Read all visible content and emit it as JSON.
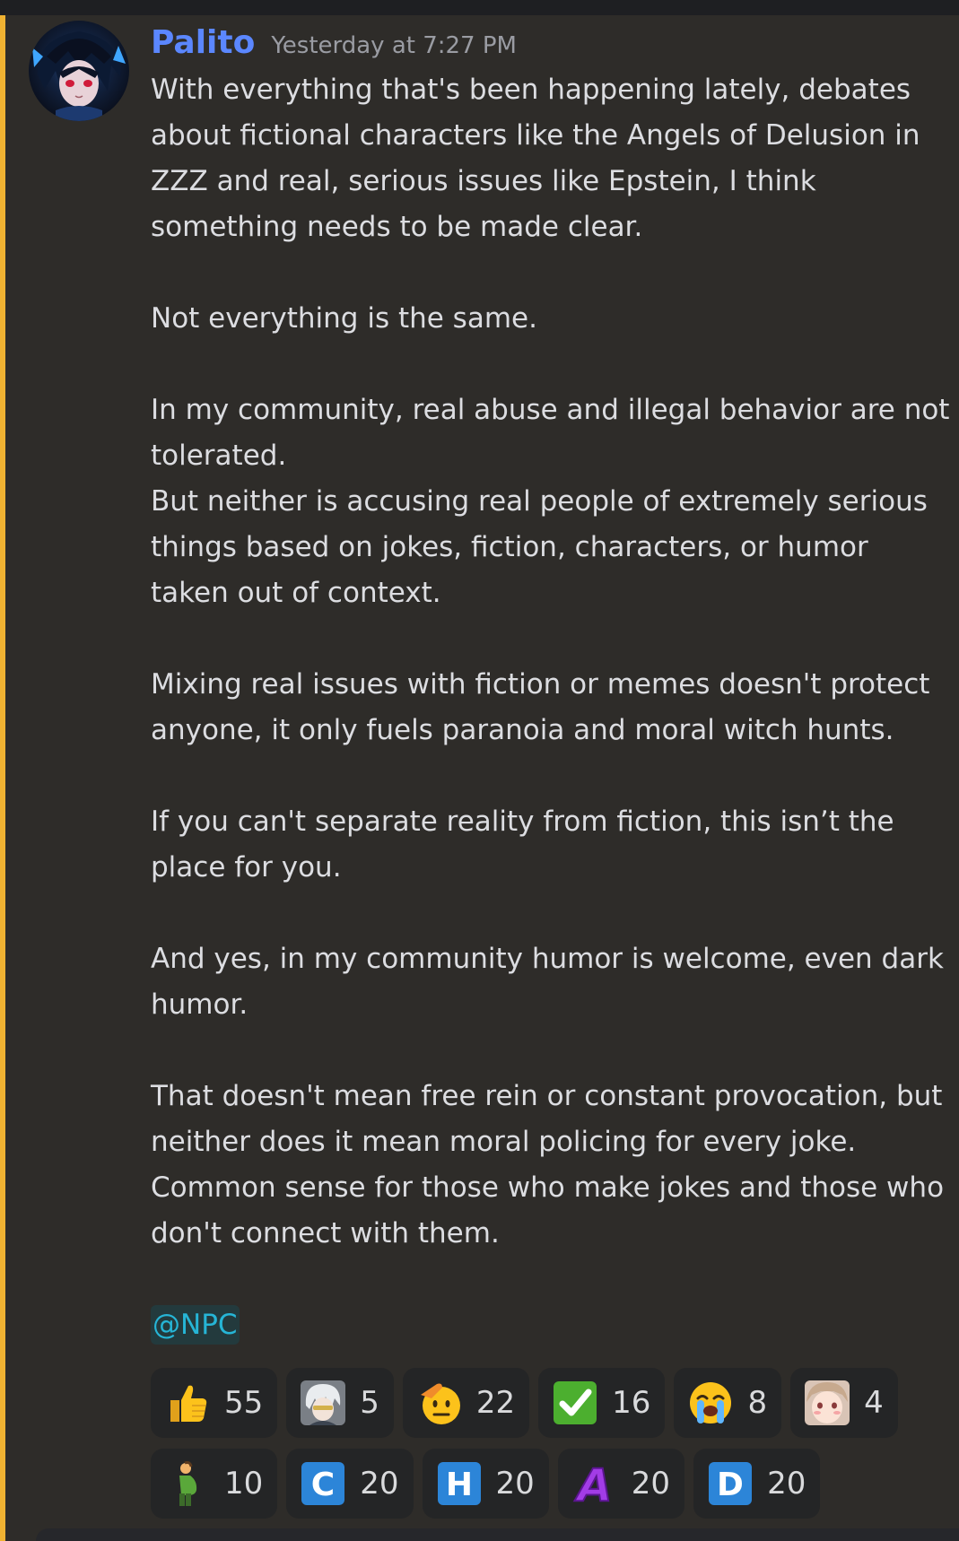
{
  "message": {
    "author": "Palito",
    "timestamp": "Yesterday at 7:27 PM",
    "avatar_icon": "anime-avatar-icon",
    "paragraphs": [
      "With everything that's been happening lately, debates about fictional characters like the Angels of Delusion in ZZZ and real, serious issues like Epstein, I think something needs to be made clear.",
      "Not everything is the same.",
      "In my community, real abuse and illegal behavior are not tolerated.\nBut neither is accusing real people of extremely serious things based on jokes, fiction, characters, or humor taken out of context.",
      "Mixing real issues with fiction or memes doesn't protect anyone, it only fuels paranoia and moral witch hunts.",
      "If you can't separate reality from fiction, this isn’t the place for you.",
      "And yes, in my community humor is welcome, even dark humor.",
      "That doesn't mean free rein or constant provocation, but neither does it mean moral policing for every joke.\nCommon sense for those who make jokes and those who don't connect with them."
    ],
    "mention": "@NPC"
  },
  "reactions": [
    {
      "emoji": "thumbs-up-icon",
      "count": "55"
    },
    {
      "emoji": "anime-character-white-hair-icon",
      "count": "5"
    },
    {
      "emoji": "saluting-face-icon",
      "count": "22"
    },
    {
      "emoji": "check-mark-button-icon",
      "count": "16"
    },
    {
      "emoji": "loudly-crying-face-icon",
      "count": "8"
    },
    {
      "emoji": "anime-girl-blush-icon",
      "count": "4"
    },
    {
      "emoji": "pregnant-man-icon",
      "count": "10"
    },
    {
      "emoji": "letter-c-icon",
      "count": "20",
      "letter": "C"
    },
    {
      "emoji": "letter-h-icon",
      "count": "20",
      "letter": "H"
    },
    {
      "emoji": "letter-a-purple-icon",
      "count": "20",
      "letter": "A"
    },
    {
      "emoji": "letter-d-icon",
      "count": "20",
      "letter": "D"
    }
  ],
  "colors": {
    "background": "#2e2c29",
    "accent_bar": "#f0b232",
    "username": "#5b87ff",
    "mention": "#26b5d6",
    "reaction_bg": "#242526"
  }
}
